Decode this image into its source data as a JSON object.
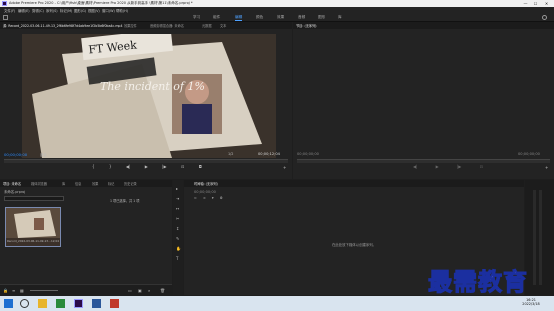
{
  "titlebar": {
    "title": "Adobe Premiere Pro 2020 - C:\\用户\\fish\\桌面\\素材\\Premiere Pro 2020 从新手到高手 \\素材\\第11\\未命名.prproj *",
    "min": "—",
    "max": "☐",
    "close": "✕"
  },
  "menu": [
    "文件(F)",
    "编辑(E)",
    "剪辑(C)",
    "序列(S)",
    "标记(M)",
    "图形(G)",
    "视图(V)",
    "窗口(W)",
    "帮助(H)"
  ],
  "workspaces": [
    "学习",
    "组件",
    "编辑",
    "颜色",
    "效果",
    "音频",
    "图形",
    "库"
  ],
  "source": {
    "tabs": [
      "源: Record_2022-03-06-11-49-13_2f6b6fe98f7d4ab9ee1f2b5b6f0ba4c.mp4",
      "效果控件",
      "音频剪辑混合器: 未命名",
      "元数据",
      "文本"
    ],
    "video_text": "The incident of 1%",
    "newspaper_header": "FT Week",
    "time_left": "00;00;00;00",
    "fit": "适合",
    "time_right": "00;00;12;04",
    "zoom": "1/2"
  },
  "program": {
    "tabs": [
      "节目: (无序列)"
    ],
    "time_left": "00;00;00;00",
    "time_right": "00;00;00;00"
  },
  "project": {
    "tabs": [
      "项目: 未命名",
      "媒体浏览器",
      "库",
      "信息",
      "效果",
      "标记",
      "历史记录"
    ],
    "file": "未命名.prproj",
    "selection": "1 项已选择，共 1 项",
    "clip_name": "Record_2022-03-06-11-49-13...",
    "clip_dur": "12;04"
  },
  "timeline": {
    "tab": "时间轴: (无序列)",
    "time": "00;00;00;00",
    "empty": "在此处放下媒体以创建序列。"
  },
  "taskbar": {
    "time": "16:21",
    "date": "2022/3/18"
  },
  "watermark": "最需教育"
}
